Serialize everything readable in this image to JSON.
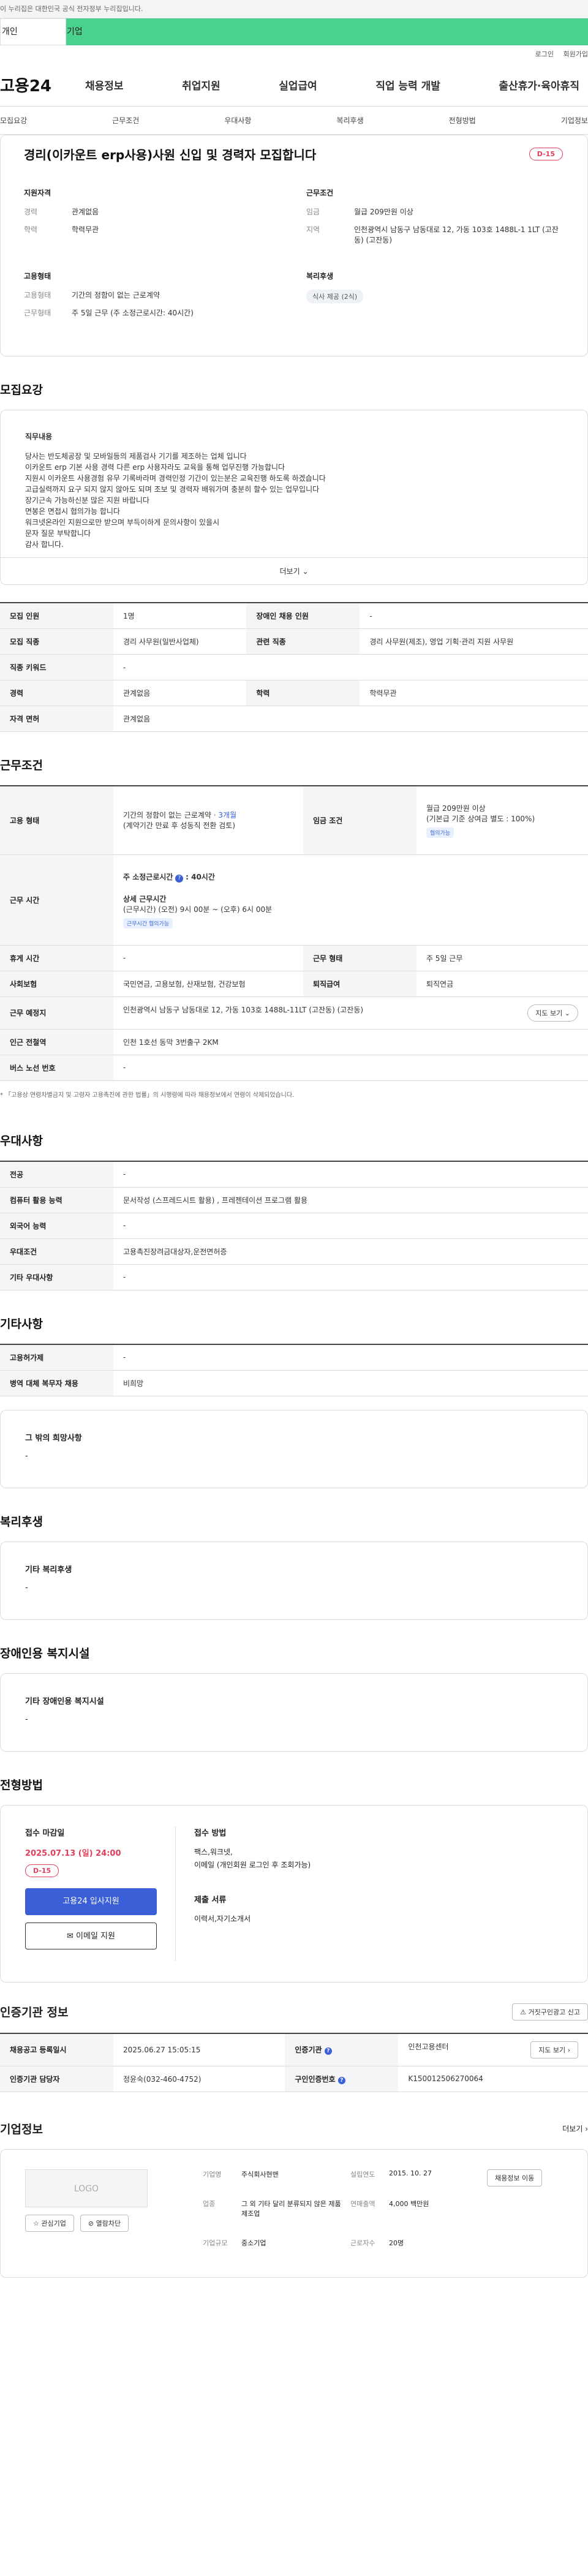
{
  "topbar": {
    "notice": "이 누리집은 대한민국 공식 전자정부 누리집입니다."
  },
  "usertabs": {
    "personal": "개인",
    "company": "기업"
  },
  "util": {
    "login": "로그인",
    "signup": "회원가입"
  },
  "gnb": {
    "logo": "고용24",
    "menu": [
      "채용정보",
      "취업지원",
      "실업급여",
      "직업 능력 개발",
      "출산휴가·육아휴직"
    ]
  },
  "subnav": [
    "모집요강",
    "근무조건",
    "우대사항",
    "복리후생",
    "전형방법",
    "기업정보"
  ],
  "job": {
    "title": "경리(이카운트 erp사용)사원 신입 및 경력자 모집합니다",
    "dday": "D-15",
    "qualification": {
      "heading": "지원자격",
      "career_k": "경력",
      "career_v": "관계없음",
      "edu_k": "학력",
      "edu_v": "학력무관"
    },
    "condition": {
      "heading": "근무조건",
      "wage_k": "임금",
      "wage_v": "월급 209만원 이상",
      "region_k": "지역",
      "region_v": "인천광역시 남동구 남동대로 12, 가동 103호 1488L-1 1LT (고잔동) (고잔동)"
    },
    "employment": {
      "heading": "고용형태",
      "type_k": "고용형태",
      "type_v": "기간의 정함이 없는 근로계약",
      "hours_k": "근무형태",
      "hours_v": "주 5일 근무 (주 소정근로시간: 40시간)"
    },
    "welfare": {
      "heading": "복리후생",
      "tag": "식사 제공 (2식)"
    }
  },
  "recruit": {
    "title": "모집요강",
    "desc_heading": "직무내용",
    "desc_lines": [
      "당사는 반도체공장 및 모바일등의 제품검사 기기를 제조하는 업체 입니다",
      "이카운트 erp 기본 사용 경력 다른 erp 사용자라도 교육을 통해 업무진행 가능합니다",
      "지원시 이카운트 사용경험 유무 기록바라며 경력인정 기간이 있는분은 교육진행 하도록 하겠습니다",
      "고급실력까지 요구 되지 않지 않아도 되며 조보 및 경력자 배워가며 충분히 할수 있는 업무입니다",
      "장기근속 가능하신분 많은 지원 바랍니다",
      "면봉은 면접시 협의가능 합니다",
      "워크넷온라인 지원으로만 받으며 부득이하게 문의사항이 있을시",
      "문자 질문 부탁합니다",
      "감사 합니다."
    ],
    "more": "더보기"
  },
  "recruit_table": {
    "count_k": "모집 인원",
    "count_v": "1명",
    "disabled_k": "장애인 채용 인원",
    "disabled_v": "-",
    "job_k": "모집 직종",
    "job_v": "경리 사무원(일반사업체)",
    "related_k": "관련 직종",
    "related_v": "경리 사무원(제조), 영업 기획·관리 지원 사무원",
    "keyword_k": "직종 키워드",
    "keyword_v": "-",
    "career_k": "경력",
    "career_v": "관계없음",
    "edu_k": "학력",
    "edu_v": "학력무관",
    "license_k": "자격 면허",
    "license_v": "관계없음"
  },
  "work": {
    "title": "근무조건",
    "emp_k": "고용 형태",
    "emp_v": "기간의 정함이 없는 근로계약",
    "emp_link": "· 3개월",
    "emp_v2": "(계약기간 만료 후 성동직 전환 검토)",
    "wage_k": "임금 조건",
    "wage_v": "월급 209만원 이상",
    "wage_v2": "(기본급 기준 상여금 별도 : 100%)",
    "wage_tag": "협의가능",
    "time_k": "근무 시간",
    "time_title": "주 소정근로시간",
    "time_val": ": 40시간",
    "time_sub": "상세 근무시간",
    "time_detail": "(근무시간) (오전) 9시 00분 ~ (오후) 6시 00분",
    "time_tag": "근무시간 협의가능",
    "rest_k": "휴게 시간",
    "rest_v": "-",
    "form_k": "근무 형태",
    "form_v": "주 5일 근무",
    "ins_k": "사회보험",
    "ins_v": "국민연금, 고용보험, 산재보험, 건강보험",
    "sev_k": "퇴직급여",
    "sev_v": "퇴직연금",
    "place_k": "근무 예정지",
    "place_v": "인천광역시 남동구 남동대로 12, 가동 103호 1488L-11LT (고잔동) (고잔동)",
    "map_btn": "지도 보기",
    "subway_k": "인근 전철역",
    "subway_v": "인천 1호선 동막 3번출구 2KM",
    "bus_k": "버스 노선 번호",
    "bus_v": "-",
    "note": "* 「고용상 연령차별금지 및 고령자 고용촉진에 관한 법률」의 시행령에 따라 채용정보에서 연령이 삭제되었습니다."
  },
  "pref": {
    "title": "우대사항",
    "rows": [
      {
        "k": "전공",
        "v": "-"
      },
      {
        "k": "컴퓨터 활용 능력",
        "v": "문서작성 (스프레드시트 활용) , 프레젠테이션 프로그램 활용"
      },
      {
        "k": "외국어 능력",
        "v": "-"
      },
      {
        "k": "우대조건",
        "v": "고용촉진장려금대상자,운전면허증"
      },
      {
        "k": "기타 우대사항",
        "v": "-"
      }
    ]
  },
  "etc": {
    "title": "기타사항",
    "rows": [
      {
        "k": "고용허가제",
        "v": "-"
      },
      {
        "k": "병역 대체 복무자 채용",
        "v": "비희망"
      }
    ],
    "box_title": "그 밖의 희망사항",
    "box_v": "-"
  },
  "welfare": {
    "title": "복리후생",
    "box_title": "기타 복리후생",
    "box_v": "-"
  },
  "disabled": {
    "title": "장애인용 복지시설",
    "box_title": "기타 장애인용 복지시설",
    "box_v": "-"
  },
  "selection": {
    "title": "전형방법",
    "deadline_k": "접수 마감일",
    "deadline_v": "2025.07.13 (일) 24:00",
    "dday": "D-15",
    "apply_btn": "고용24 입사지원",
    "email_btn": "이메일 지원",
    "method_k": "접수 방법",
    "method_v1": "팩스,워크넷,",
    "method_v2": "이메일 (개인회원 로그인 후 조회가능)",
    "docs_k": "제출 서류",
    "docs_v": "이력서,자기소개서"
  },
  "cert": {
    "title": "인증기관 정보",
    "report_btn": "거짓구인광고 신고",
    "reg_k": "채용공고 등록일시",
    "reg_v": "2025.06.27 15:05:15",
    "agency_k": "인증기관",
    "agency_v": "인천고용센터",
    "map_btn": "지도 보기",
    "mgr_k": "인증기관 담당자",
    "mgr_v": "정윤숙(032-460-4752)",
    "id_k": "구인인증번호",
    "id_v": "K150012506270064"
  },
  "company": {
    "title": "기업정보",
    "more": "더보기",
    "logo": "LOGO",
    "fav_btn": "관심기업",
    "block_btn": "열람차단",
    "name_k": "기업명",
    "name_v": "주식회사현맨",
    "ind_k": "업종",
    "ind_v": "그 외 기타 달리 분류되지 않은 제품 제조업",
    "size_k": "기업규모",
    "size_v": "중소기업",
    "year_k": "설립연도",
    "year_v": "2015. 10. 27",
    "sales_k": "연매출액",
    "sales_v": "4,000 백만원",
    "emp_k": "근로자수",
    "emp_v": "20명",
    "jobs_btn": "채용정보 이동"
  }
}
